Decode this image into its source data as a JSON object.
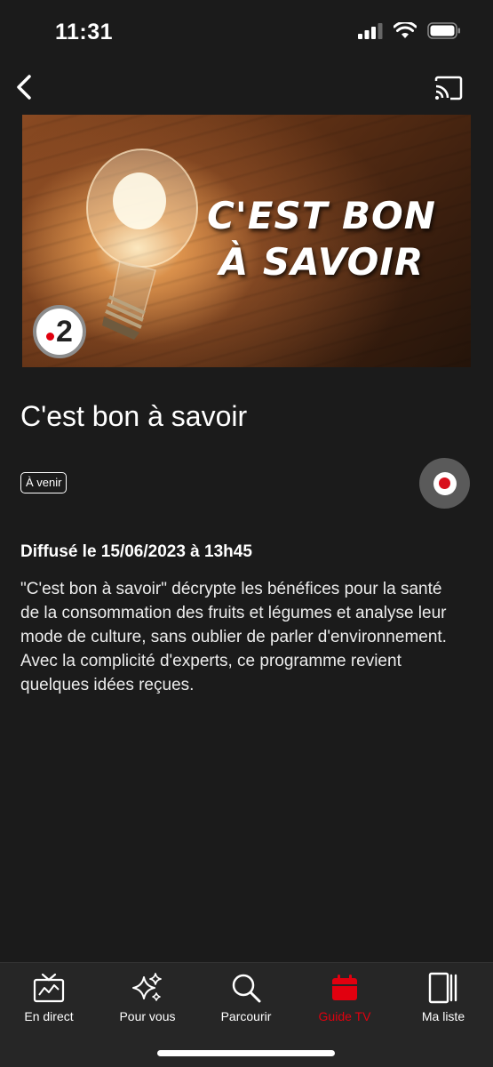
{
  "status": {
    "time": "11:31",
    "icons": [
      "cellular-signal-icon",
      "wifi-icon",
      "battery-icon"
    ]
  },
  "nav": {
    "icons": [
      "chevron-left-icon",
      "cast-icon"
    ]
  },
  "hero": {
    "image_title_line1": "C'EST BON",
    "image_title_line2": "À SAVOIR",
    "channel_number": "2"
  },
  "program": {
    "title": "C'est bon à savoir",
    "badge": "À venir",
    "airing": "Diffusé le 15/06/2023 à 13h45",
    "description": "\"C'est bon à savoir\" décrypte les bénéfices pour la santé de la consommation des fruits et légumes et analyse leur mode de culture, sans oublier de parler d'environnement. Avec la complicité d'experts, ce programme revient quelques idées reçues."
  },
  "tabs": [
    {
      "label": "En direct",
      "icon": "tv-icon",
      "active": false
    },
    {
      "label": "Pour vous",
      "icon": "sparkles-icon",
      "active": false
    },
    {
      "label": "Parcourir",
      "icon": "search-icon",
      "active": false
    },
    {
      "label": "Guide TV",
      "icon": "calendar-icon",
      "active": true
    },
    {
      "label": "Ma liste",
      "icon": "library-icon",
      "active": false
    }
  ],
  "colors": {
    "accent": "#e1000f",
    "background": "#1b1b1b",
    "tab_bar": "#262626"
  }
}
